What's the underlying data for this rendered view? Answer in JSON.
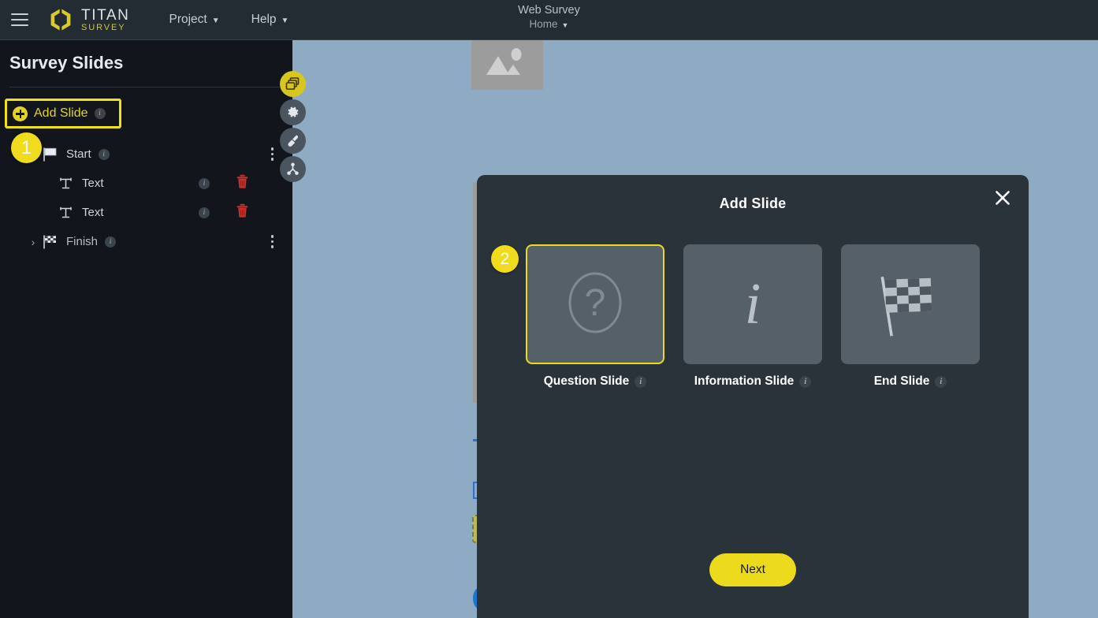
{
  "topbar": {
    "menu_icon": "hamburger-icon",
    "logo": {
      "title": "TITAN",
      "subtitle": "SURVEY",
      "icon": "titan-hex-logo-icon"
    },
    "nav": [
      {
        "label": "Project",
        "icon": "chevron-down-icon"
      },
      {
        "label": "Help",
        "icon": "chevron-down-icon"
      }
    ],
    "center": {
      "title": "Web Survey",
      "subtitle": "Home",
      "subtitle_icon": "chevron-down-icon"
    }
  },
  "sidebar": {
    "title": "Survey Slides",
    "add_slide": {
      "label": "Add Slide",
      "icon": "plus-circle-icon",
      "info": "i"
    },
    "tree": [
      {
        "label": "Start",
        "icon": "white-flag-icon",
        "info": "i",
        "level": "root",
        "chevron": "",
        "menu": "kebab-menu-icon",
        "trash": ""
      },
      {
        "label": "Text",
        "icon": "text-field-icon",
        "info": "i",
        "level": "child",
        "chevron": "",
        "menu": "",
        "trash": "trash-icon"
      },
      {
        "label": "Text",
        "icon": "text-field-icon",
        "info": "i",
        "level": "child",
        "chevron": "",
        "menu": "",
        "trash": "trash-icon"
      },
      {
        "label": "Finish",
        "icon": "checkered-flag-icon",
        "info": "i",
        "level": "root",
        "chevron": "›",
        "menu": "kebab-menu-icon",
        "trash": ""
      }
    ],
    "tools": [
      {
        "name": "slides-layers-icon",
        "active": true
      },
      {
        "name": "gear-icon",
        "active": false
      },
      {
        "name": "paintbrush-icon",
        "active": false
      },
      {
        "name": "flow-nodes-icon",
        "active": false
      }
    ]
  },
  "annotations": [
    {
      "number": "1"
    },
    {
      "number": "2"
    }
  ],
  "canvas": {
    "image_placeholder_icon": "image-placeholder-icon"
  },
  "modal": {
    "title": "Add Slide",
    "close_icon": "close-icon",
    "cards": [
      {
        "label": "Question Slide",
        "icon": "question-mark-circle-icon",
        "info": "i",
        "selected": true
      },
      {
        "label": "Information Slide",
        "icon": "information-italic-i-icon",
        "info": "i",
        "selected": false
      },
      {
        "label": "End Slide",
        "icon": "checkered-flag-icon",
        "info": "i",
        "selected": false
      }
    ],
    "next_label": "Next"
  },
  "colors": {
    "brand_yellow": "#ecdb1c",
    "topbar_bg": "#232b33",
    "sidebar_bg": "#12161c",
    "canvas_bg": "#8fabc4",
    "modal_bg": "#2b333a",
    "card_bg": "#566069",
    "danger_red": "#c4302b"
  }
}
